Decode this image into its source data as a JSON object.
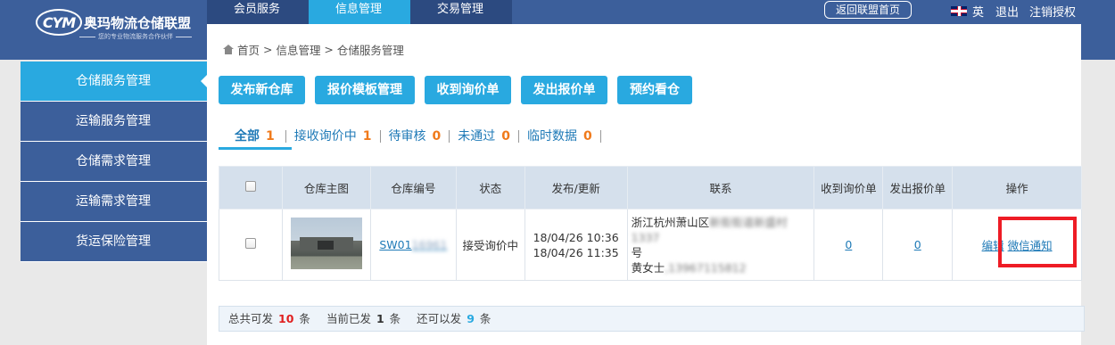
{
  "header": {
    "logo_mark": "CYM",
    "logo_name": "奥玛物流仓储联盟",
    "logo_slogan": "您的专业物流服务合作伙伴",
    "nav_tabs": [
      {
        "label": "会员服务"
      },
      {
        "label": "信息管理"
      },
      {
        "label": "交易管理"
      }
    ],
    "back_button": "返回联盟首页",
    "language": "英",
    "logout": "退出",
    "cancel_auth": "注销授权"
  },
  "breadcrumb": [
    "首页",
    "信息管理",
    "仓储服务管理"
  ],
  "sidebar": {
    "items": [
      {
        "label": "仓储服务管理"
      },
      {
        "label": "运输服务管理"
      },
      {
        "label": "仓储需求管理"
      },
      {
        "label": "运输需求管理"
      },
      {
        "label": "货运保险管理"
      }
    ]
  },
  "actions": [
    "发布新仓库",
    "报价模板管理",
    "收到询价单",
    "发出报价单",
    "预约看仓"
  ],
  "filters": [
    {
      "label": "全部",
      "count": "1"
    },
    {
      "label": "接收询价中",
      "count": "1"
    },
    {
      "label": "待审核",
      "count": "0"
    },
    {
      "label": "未通过",
      "count": "0"
    },
    {
      "label": "临时数据",
      "count": "0"
    }
  ],
  "table": {
    "headers": [
      "仓库主图",
      "仓库编号",
      "状态",
      "发布/更新",
      "联系",
      "收到询价单",
      "发出报价单",
      "操作"
    ],
    "rows": [
      {
        "code_visible": "SW01",
        "code_blurred": "16961",
        "status": "接受询价中",
        "published": "18/04/26 10:36",
        "updated": "18/04/26 11:35",
        "contact_line1": "浙江杭州萧山区",
        "contact_line1_blurred": "新街街道新盛村1337",
        "contact_line2": "号",
        "contact_line3": "黄女士",
        "contact_line3_blurred": ",13967115812",
        "inquiries": "0",
        "quotes": "0",
        "op_edit": "编辑",
        "op_wechat": "微信通知"
      }
    ]
  },
  "footer": {
    "total_label": "总共可发",
    "total_value": "10",
    "total_unit": "条",
    "sent_label": "当前已发",
    "sent_value": "1",
    "sent_unit": "条",
    "remaining_label": "还可以发",
    "remaining_value": "9",
    "remaining_unit": "条"
  }
}
